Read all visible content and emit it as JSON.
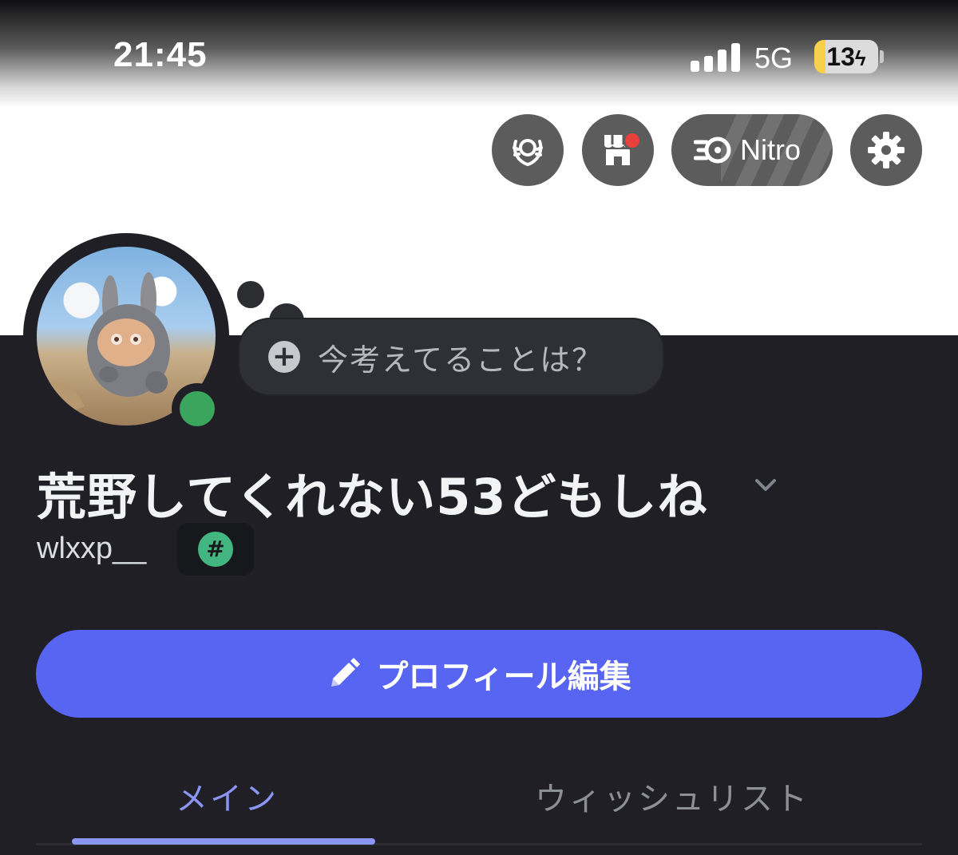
{
  "status_bar": {
    "time": "21:45",
    "network": "5G",
    "battery": "13"
  },
  "top_actions": {
    "nitro_label": "Nitro",
    "shop_has_notification": true
  },
  "profile": {
    "status_prompt": "今考えてることは？",
    "display_name": "荒野してくれない53どもしね",
    "username": "wlxxp__",
    "online_status": "online",
    "badge_symbol": "#"
  },
  "edit_button": {
    "label": "プロフィール編集"
  },
  "tabs": [
    {
      "label": "メイン",
      "active": true
    },
    {
      "label": "ウィッシュリスト",
      "active": false
    }
  ],
  "colors": {
    "accent": "#5865f2",
    "tab_active": "#8b95f4",
    "online": "#3ba55d",
    "badge": "#43b581",
    "notification": "#e8413c",
    "background": "#1f1f25"
  }
}
